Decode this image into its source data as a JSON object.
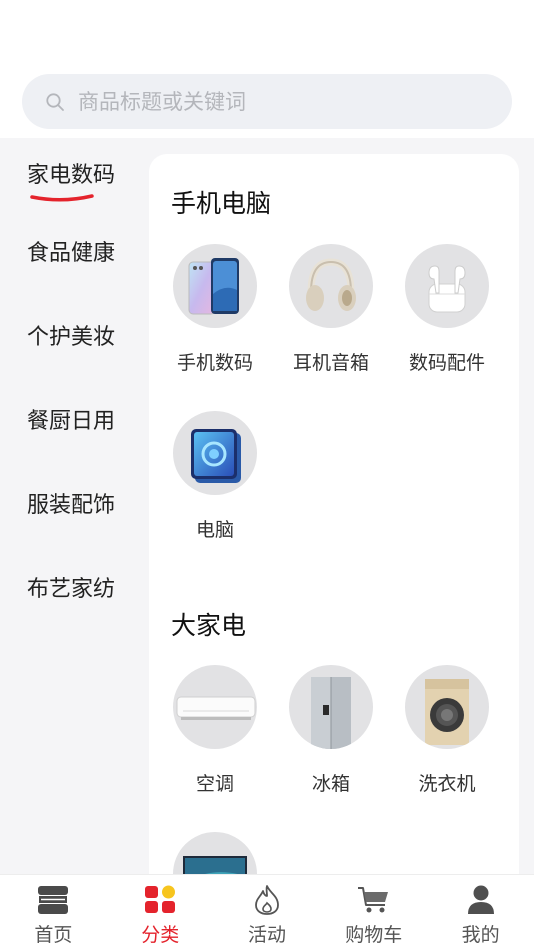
{
  "search": {
    "placeholder": "商品标题或关键词"
  },
  "sidebar": {
    "items": [
      {
        "label": "家电数码",
        "active": true
      },
      {
        "label": "食品健康"
      },
      {
        "label": "个护美妆"
      },
      {
        "label": "餐厨日用"
      },
      {
        "label": "服装配饰"
      },
      {
        "label": "布艺家纺"
      }
    ]
  },
  "sections": [
    {
      "title": "手机电脑",
      "items": [
        {
          "label": "手机数码",
          "icon": "phone-image-icon"
        },
        {
          "label": "耳机音箱",
          "icon": "headphones-image-icon"
        },
        {
          "label": "数码配件",
          "icon": "earbuds-image-icon"
        },
        {
          "label": "电脑",
          "icon": "tablet-image-icon"
        }
      ]
    },
    {
      "title": "大家电",
      "items": [
        {
          "label": "空调",
          "icon": "air-conditioner-image-icon"
        },
        {
          "label": "冰箱",
          "icon": "fridge-image-icon"
        },
        {
          "label": "洗衣机",
          "icon": "washing-machine-image-icon"
        },
        {
          "label": "",
          "icon": "tv-image-icon"
        }
      ]
    }
  ],
  "tabbar": {
    "tabs": [
      {
        "label": "首页",
        "icon": "home-icon"
      },
      {
        "label": "分类",
        "icon": "category-icon",
        "active": true
      },
      {
        "label": "活动",
        "icon": "flame-icon"
      },
      {
        "label": "购物车",
        "icon": "cart-icon"
      },
      {
        "label": "我的",
        "icon": "user-icon"
      }
    ]
  },
  "colors": {
    "accent": "#e4232c",
    "accent_yellow": "#f7c51e",
    "sidebar_bg": "#f5f5f7",
    "search_bg": "#eef0f4"
  }
}
